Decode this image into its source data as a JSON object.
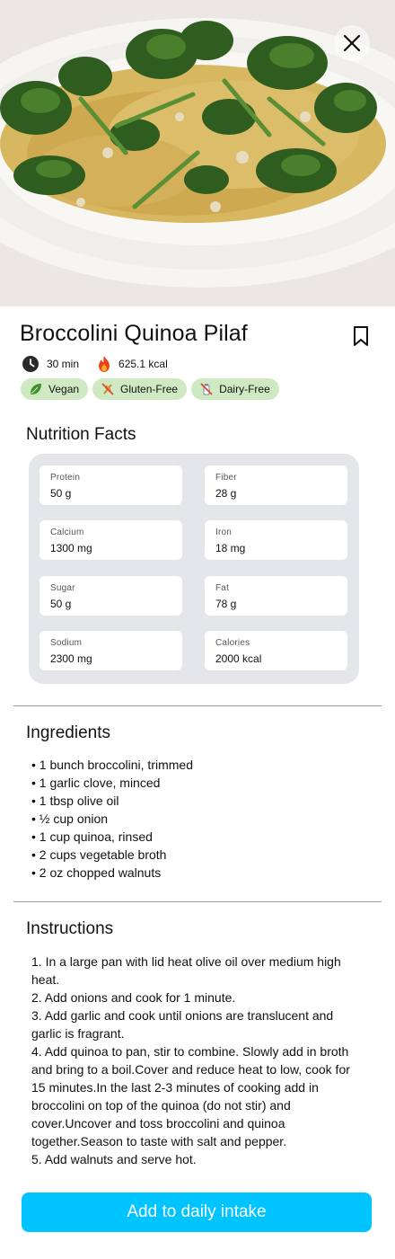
{
  "recipe": {
    "title": "Broccolini Quinoa Pilaf",
    "time": "30 min",
    "calories": "625.1 kcal",
    "tags": [
      {
        "label": "Vegan",
        "icon": "leaf-icon"
      },
      {
        "label": "Gluten-Free",
        "icon": "no-gluten-icon"
      },
      {
        "label": "Dairy-Free",
        "icon": "no-dairy-icon"
      }
    ]
  },
  "nutrition": {
    "title": "Nutrition Facts",
    "items": [
      {
        "label": "Protein",
        "value": "50 g"
      },
      {
        "label": "Fiber",
        "value": "28 g"
      },
      {
        "label": "Calcium",
        "value": "1300 mg"
      },
      {
        "label": "Iron",
        "value": "18 mg"
      },
      {
        "label": "Sugar",
        "value": "50 g"
      },
      {
        "label": "Fat",
        "value": "78 g"
      },
      {
        "label": "Sodium",
        "value": "2300 mg"
      },
      {
        "label": "Calories",
        "value": "2000 kcal"
      }
    ]
  },
  "ingredients": {
    "title": "Ingredients",
    "items": [
      "1 bunch broccolini, trimmed",
      "1 garlic clove, minced",
      "1 tbsp olive oil",
      "½ cup onion",
      "1 cup quinoa, rinsed",
      "2 cups vegetable broth",
      "2 oz chopped walnuts"
    ]
  },
  "instructions": {
    "title": "Instructions",
    "steps": [
      "1. In a large pan with lid heat olive oil over medium high heat.",
      "2. Add onions and cook for 1 minute.",
      "3. Add garlic and cook until onions are translucent and garlic is fragrant.",
      "4. Add quinoa to pan, stir to combine. Slowly add in broth and bring to a boil.Cover and reduce heat to low, cook for 15 minutes.In the last 2-3 minutes of cooking add in broccolini on top of the quinoa (do not stir) and cover.Uncover and toss broccolini and quinoa together.Season to taste with salt and pepper.",
      "5. Add walnuts and serve hot."
    ]
  },
  "actions": {
    "add_label": "Add to daily intake"
  },
  "colors": {
    "accent": "#00c4ff",
    "tag_bg": "#cfeac2",
    "card_bg": "#e5e6ea"
  }
}
